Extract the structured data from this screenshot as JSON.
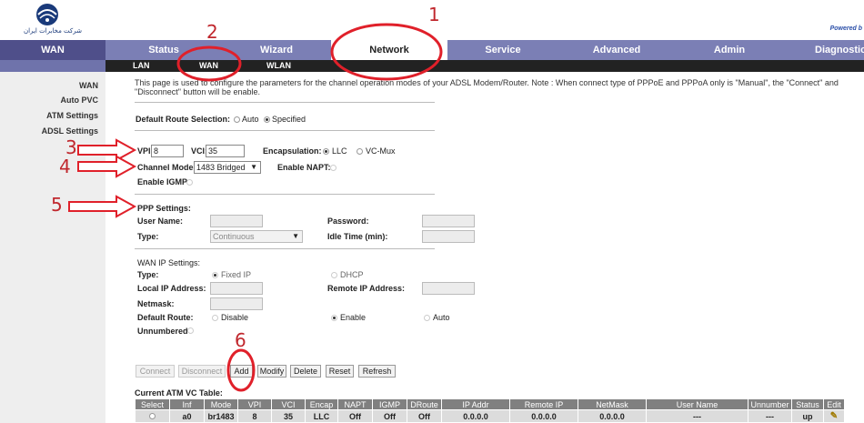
{
  "header": {
    "logo_caption": "شرکت مخابرات ایران",
    "powered_by": "Powered b"
  },
  "topnav": [
    "WAN",
    "Status",
    "Wizard",
    "Network",
    "Service",
    "Advanced",
    "Admin",
    "Diagnostic"
  ],
  "subnav": [
    "LAN",
    "WAN",
    "WLAN"
  ],
  "sidebar": [
    "WAN",
    "Auto PVC",
    "ATM Settings",
    "ADSL Settings"
  ],
  "description": "This page is used to configure the parameters for the channel operation modes of your ADSL Modem/Router. Note : When connect type of PPPoE and PPPoA only is \"Manual\", the \"Connect\" and \"Disconnect\" button will be enable.",
  "default_route": {
    "label": "Default Route Selection:",
    "auto": "Auto",
    "specified": "Specified"
  },
  "vpi": {
    "label": "VPI:",
    "value": "8"
  },
  "vci": {
    "label": "VCI:",
    "value": "35"
  },
  "encapsulation": {
    "label": "Encapsulation:",
    "llc": "LLC",
    "vcmux": "VC-Mux"
  },
  "channel_mode": {
    "label": "Channel Mode:",
    "value": "1483 Bridged"
  },
  "enable_napt": "Enable NAPT:",
  "enable_igmp": "Enable IGMP:",
  "ppp": {
    "title": "PPP Settings:",
    "username": "User Name:",
    "password": "Password:",
    "type": "Type:",
    "type_value": "Continuous",
    "idle": "Idle Time (min):"
  },
  "wanip": {
    "title": "WAN IP Settings:",
    "type": "Type:",
    "fixed": "Fixed IP",
    "dhcp": "DHCP",
    "local_ip": "Local IP Address:",
    "remote_ip": "Remote IP Address:",
    "netmask": "Netmask:",
    "default_route": "Default Route:",
    "disable": "Disable",
    "enable": "Enable",
    "auto": "Auto",
    "unnumbered": "Unnumbered"
  },
  "buttons": [
    "Connect",
    "Disconnect",
    "Add",
    "Modify",
    "Delete",
    "Reset",
    "Refresh"
  ],
  "table": {
    "title": "Current ATM VC Table:",
    "headers": [
      "Select",
      "Inf",
      "Mode",
      "VPI",
      "VCI",
      "Encap",
      "NAPT",
      "IGMP",
      "DRoute",
      "IP Addr",
      "Remote IP",
      "NetMask",
      "User Name",
      "Unnumber",
      "Status",
      "Edit"
    ],
    "rows": [
      [
        "",
        "a0",
        "br1483",
        "8",
        "35",
        "LLC",
        "Off",
        "Off",
        "Off",
        "0.0.0.0",
        "0.0.0.0",
        "0.0.0.0",
        "---",
        "---",
        "up",
        ""
      ]
    ]
  },
  "annotations": [
    "1",
    "2",
    "3",
    "4",
    "5",
    "6"
  ],
  "colors": {
    "nav": "#7b7fb5",
    "annotation": "#e0202a"
  }
}
